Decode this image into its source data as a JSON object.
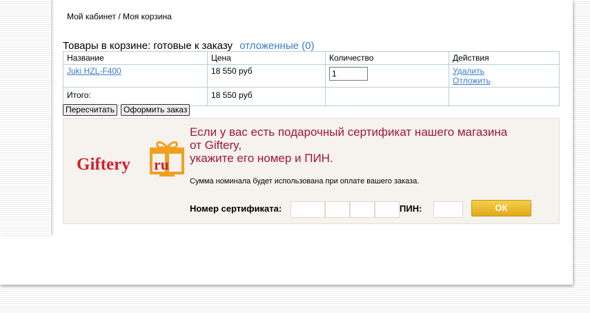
{
  "breadcrumb": "Мой кабинет / Моя корзина",
  "cart": {
    "title": "Товары в корзине:  готовые к заказу",
    "deferred_link": "отложенные (0)",
    "columns": [
      "Название",
      "Цена",
      "Количество",
      "Действия"
    ],
    "item": {
      "name": "Juki HZL-F400",
      "price": "18 550 руб",
      "quantity": "1",
      "action_delete": "Удалить",
      "action_defer": "Отложить"
    },
    "total_label": "Итого:",
    "total_value": "18 550 руб"
  },
  "buttons": {
    "recalculate": "Пересчитать",
    "checkout": "Оформить заказ"
  },
  "gift": {
    "logo_text": "Giftery.ru",
    "heading_line1": "Если у вас есть подарочный сертификат нашего магазина",
    "heading_line2": "от Giftery,",
    "heading_line3": "укажите его номер и ПИН.",
    "subtext": "Сумма номинала будет использована при оплате вашего заказа.",
    "cert_label": "Номер сертификата:",
    "pin_label": "ПИН:",
    "ok_label": "ОК",
    "colors": {
      "heading": "#a0153c",
      "ok_button": "#e8b626",
      "logo_red": "#d0202a",
      "logo_orange": "#f0a020"
    }
  }
}
